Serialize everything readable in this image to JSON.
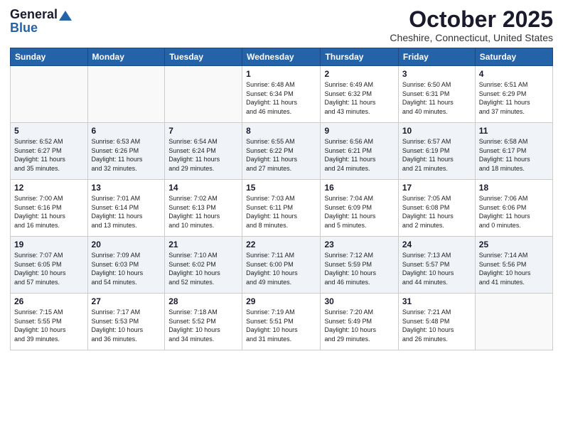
{
  "header": {
    "logo_general": "General",
    "logo_blue": "Blue",
    "month_title": "October 2025",
    "location": "Cheshire, Connecticut, United States"
  },
  "days_of_week": [
    "Sunday",
    "Monday",
    "Tuesday",
    "Wednesday",
    "Thursday",
    "Friday",
    "Saturday"
  ],
  "weeks": [
    [
      {
        "day": "",
        "info": ""
      },
      {
        "day": "",
        "info": ""
      },
      {
        "day": "",
        "info": ""
      },
      {
        "day": "1",
        "info": "Sunrise: 6:48 AM\nSunset: 6:34 PM\nDaylight: 11 hours\nand 46 minutes."
      },
      {
        "day": "2",
        "info": "Sunrise: 6:49 AM\nSunset: 6:32 PM\nDaylight: 11 hours\nand 43 minutes."
      },
      {
        "day": "3",
        "info": "Sunrise: 6:50 AM\nSunset: 6:31 PM\nDaylight: 11 hours\nand 40 minutes."
      },
      {
        "day": "4",
        "info": "Sunrise: 6:51 AM\nSunset: 6:29 PM\nDaylight: 11 hours\nand 37 minutes."
      }
    ],
    [
      {
        "day": "5",
        "info": "Sunrise: 6:52 AM\nSunset: 6:27 PM\nDaylight: 11 hours\nand 35 minutes."
      },
      {
        "day": "6",
        "info": "Sunrise: 6:53 AM\nSunset: 6:26 PM\nDaylight: 11 hours\nand 32 minutes."
      },
      {
        "day": "7",
        "info": "Sunrise: 6:54 AM\nSunset: 6:24 PM\nDaylight: 11 hours\nand 29 minutes."
      },
      {
        "day": "8",
        "info": "Sunrise: 6:55 AM\nSunset: 6:22 PM\nDaylight: 11 hours\nand 27 minutes."
      },
      {
        "day": "9",
        "info": "Sunrise: 6:56 AM\nSunset: 6:21 PM\nDaylight: 11 hours\nand 24 minutes."
      },
      {
        "day": "10",
        "info": "Sunrise: 6:57 AM\nSunset: 6:19 PM\nDaylight: 11 hours\nand 21 minutes."
      },
      {
        "day": "11",
        "info": "Sunrise: 6:58 AM\nSunset: 6:17 PM\nDaylight: 11 hours\nand 18 minutes."
      }
    ],
    [
      {
        "day": "12",
        "info": "Sunrise: 7:00 AM\nSunset: 6:16 PM\nDaylight: 11 hours\nand 16 minutes."
      },
      {
        "day": "13",
        "info": "Sunrise: 7:01 AM\nSunset: 6:14 PM\nDaylight: 11 hours\nand 13 minutes."
      },
      {
        "day": "14",
        "info": "Sunrise: 7:02 AM\nSunset: 6:13 PM\nDaylight: 11 hours\nand 10 minutes."
      },
      {
        "day": "15",
        "info": "Sunrise: 7:03 AM\nSunset: 6:11 PM\nDaylight: 11 hours\nand 8 minutes."
      },
      {
        "day": "16",
        "info": "Sunrise: 7:04 AM\nSunset: 6:09 PM\nDaylight: 11 hours\nand 5 minutes."
      },
      {
        "day": "17",
        "info": "Sunrise: 7:05 AM\nSunset: 6:08 PM\nDaylight: 11 hours\nand 2 minutes."
      },
      {
        "day": "18",
        "info": "Sunrise: 7:06 AM\nSunset: 6:06 PM\nDaylight: 11 hours\nand 0 minutes."
      }
    ],
    [
      {
        "day": "19",
        "info": "Sunrise: 7:07 AM\nSunset: 6:05 PM\nDaylight: 10 hours\nand 57 minutes."
      },
      {
        "day": "20",
        "info": "Sunrise: 7:09 AM\nSunset: 6:03 PM\nDaylight: 10 hours\nand 54 minutes."
      },
      {
        "day": "21",
        "info": "Sunrise: 7:10 AM\nSunset: 6:02 PM\nDaylight: 10 hours\nand 52 minutes."
      },
      {
        "day": "22",
        "info": "Sunrise: 7:11 AM\nSunset: 6:00 PM\nDaylight: 10 hours\nand 49 minutes."
      },
      {
        "day": "23",
        "info": "Sunrise: 7:12 AM\nSunset: 5:59 PM\nDaylight: 10 hours\nand 46 minutes."
      },
      {
        "day": "24",
        "info": "Sunrise: 7:13 AM\nSunset: 5:57 PM\nDaylight: 10 hours\nand 44 minutes."
      },
      {
        "day": "25",
        "info": "Sunrise: 7:14 AM\nSunset: 5:56 PM\nDaylight: 10 hours\nand 41 minutes."
      }
    ],
    [
      {
        "day": "26",
        "info": "Sunrise: 7:15 AM\nSunset: 5:55 PM\nDaylight: 10 hours\nand 39 minutes."
      },
      {
        "day": "27",
        "info": "Sunrise: 7:17 AM\nSunset: 5:53 PM\nDaylight: 10 hours\nand 36 minutes."
      },
      {
        "day": "28",
        "info": "Sunrise: 7:18 AM\nSunset: 5:52 PM\nDaylight: 10 hours\nand 34 minutes."
      },
      {
        "day": "29",
        "info": "Sunrise: 7:19 AM\nSunset: 5:51 PM\nDaylight: 10 hours\nand 31 minutes."
      },
      {
        "day": "30",
        "info": "Sunrise: 7:20 AM\nSunset: 5:49 PM\nDaylight: 10 hours\nand 29 minutes."
      },
      {
        "day": "31",
        "info": "Sunrise: 7:21 AM\nSunset: 5:48 PM\nDaylight: 10 hours\nand 26 minutes."
      },
      {
        "day": "",
        "info": ""
      }
    ]
  ]
}
